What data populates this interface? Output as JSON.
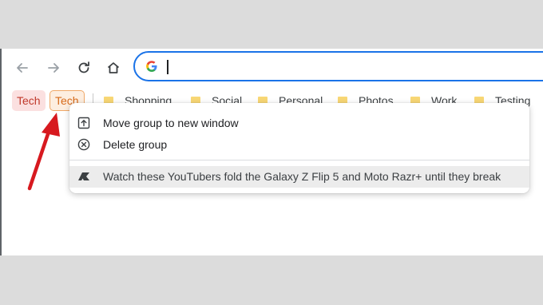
{
  "toolbar": {
    "back_icon": "arrow-left",
    "forward_icon": "arrow-right",
    "reload_icon": "reload",
    "home_icon": "home",
    "omnibox_value": ""
  },
  "bookmarks_bar": {
    "tab_groups": [
      {
        "label": "Tech",
        "color": "#fbe0e0"
      },
      {
        "label": "Tech",
        "color": "#fdeee0",
        "border": "#f0a868"
      }
    ],
    "folders": [
      "Shopping",
      "Social",
      "Personal",
      "Photos",
      "Work",
      "Testing"
    ],
    "folder_color": "#f8d775"
  },
  "context_menu": {
    "items": [
      {
        "label": "Move group to new window",
        "icon": "open-in-new-window"
      },
      {
        "label": "Delete group",
        "icon": "close-circle"
      }
    ],
    "tabs": [
      {
        "label": "Watch these YouTubers fold the Galaxy Z Flip 5 and Moto Razr+ until they break",
        "icon": "site-favicon"
      }
    ]
  },
  "annotation": {
    "arrow_color": "#d7191f"
  }
}
